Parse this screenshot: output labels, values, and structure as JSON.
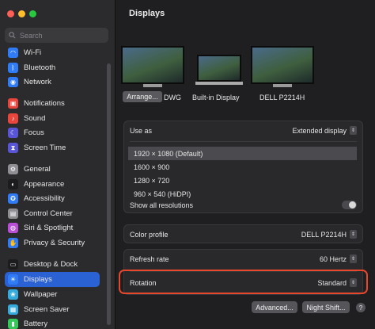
{
  "search": {
    "placeholder": "Search"
  },
  "sidebar": {
    "items": [
      {
        "label": "Wi-Fi",
        "icon": "wifi-icon",
        "color": "#2f7cf6",
        "glyph": "◠"
      },
      {
        "label": "Bluetooth",
        "icon": "bluetooth-icon",
        "color": "#2f7cf6",
        "glyph": "ᛒ"
      },
      {
        "label": "Network",
        "icon": "network-icon",
        "color": "#2f7cf6",
        "glyph": "◉"
      },
      {
        "label": "Notifications",
        "icon": "notifications-icon",
        "color": "#e8453c",
        "glyph": "▣"
      },
      {
        "label": "Sound",
        "icon": "sound-icon",
        "color": "#e8453c",
        "glyph": "♪"
      },
      {
        "label": "Focus",
        "icon": "focus-icon",
        "color": "#5856d6",
        "glyph": "☾"
      },
      {
        "label": "Screen Time",
        "icon": "screen-time-icon",
        "color": "#5856d6",
        "glyph": "⧗"
      },
      {
        "label": "General",
        "icon": "gear-icon",
        "color": "#8e8e93",
        "glyph": "⚙"
      },
      {
        "label": "Appearance",
        "icon": "appearance-icon",
        "color": "#1c1c1e",
        "glyph": "◐"
      },
      {
        "label": "Accessibility",
        "icon": "accessibility-icon",
        "color": "#2f7cf6",
        "glyph": "✪"
      },
      {
        "label": "Control Center",
        "icon": "control-center-icon",
        "color": "#8e8e93",
        "glyph": "▤"
      },
      {
        "label": "Siri & Spotlight",
        "icon": "siri-icon",
        "color": "#b84fd6",
        "glyph": "◍"
      },
      {
        "label": "Privacy & Security",
        "icon": "privacy-hand-icon",
        "color": "#2f7cf6",
        "glyph": "✋"
      },
      {
        "label": "Desktop & Dock",
        "icon": "dock-icon",
        "color": "#1c1c1e",
        "glyph": "▭"
      },
      {
        "label": "Displays",
        "icon": "displays-icon",
        "color": "#2f7cf6",
        "glyph": "☀"
      },
      {
        "label": "Wallpaper",
        "icon": "wallpaper-icon",
        "color": "#35aadc",
        "glyph": "❀"
      },
      {
        "label": "Screen Saver",
        "icon": "screen-saver-icon",
        "color": "#35aadc",
        "glyph": "▦"
      },
      {
        "label": "Battery",
        "icon": "battery-icon",
        "color": "#34c759",
        "glyph": "▮"
      }
    ]
  },
  "main": {
    "title": "Displays",
    "arrange_label": "Arrange...",
    "monitors": [
      {
        "label": "DWG"
      },
      {
        "label": "Built-in Display"
      },
      {
        "label": "DELL P2214H"
      }
    ],
    "use_as": {
      "label": "Use as",
      "value": "Extended display"
    },
    "resolutions": [
      "1920 × 1080 (Default)",
      "1600 × 900",
      "1280 × 720",
      "960 × 540 (HiDPI)"
    ],
    "show_all": {
      "label": "Show all resolutions",
      "enabled": false
    },
    "color_profile": {
      "label": "Color profile",
      "value": "DELL P2214H"
    },
    "refresh_rate": {
      "label": "Refresh rate",
      "value": "60 Hertz"
    },
    "rotation": {
      "label": "Rotation",
      "value": "Standard"
    },
    "buttons": {
      "advanced": "Advanced...",
      "night_shift": "Night Shift...",
      "help": "?"
    }
  },
  "colors": {
    "accent": "#2b62d3",
    "highlight": "#e8472c"
  }
}
